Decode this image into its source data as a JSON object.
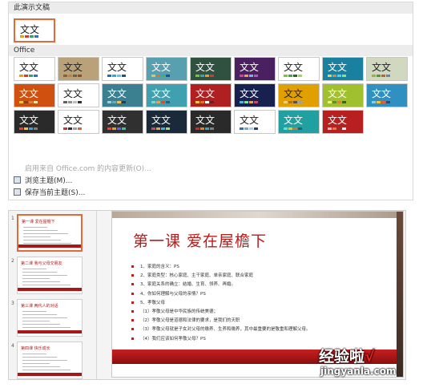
{
  "gallery": {
    "this_presentation_label": "此演示文稿",
    "office_label": "Office",
    "sample_text": "文文",
    "current_theme_text": "文文",
    "menu": {
      "enable_updates": "启用来自 Office.com 的内容更新(O)...",
      "browse": "浏览主题(M)...",
      "save": "保存当前主题(S)..."
    },
    "themes": [
      {
        "bg": "#ffffff",
        "fg": "#222222",
        "bars": [
          "#e4a020",
          "#d04020",
          "#40a060",
          "#3070c0"
        ]
      },
      {
        "bg": "#b9a27a",
        "fg": "#222222",
        "bars": [
          "#8a6030",
          "#c08040",
          "#606060",
          "#a04030"
        ]
      },
      {
        "bg": "#ffffff",
        "fg": "#222222",
        "bars": [
          "#2070b0",
          "#40a0d0",
          "#70c0e0",
          "#205080"
        ]
      },
      {
        "bg": "#58a0b0",
        "fg": "#ffffff",
        "bars": [
          "#f0c040",
          "#e07030",
          "#40b070",
          "#2050a0"
        ]
      },
      {
        "bg": "#305040",
        "fg": "#ffffff",
        "bars": [
          "#80c040",
          "#40a0c0",
          "#e0a030",
          "#c04040"
        ]
      },
      {
        "bg": "#4a2060",
        "fg": "#ffffff",
        "bars": [
          "#e04080",
          "#f0a040",
          "#60c0e0",
          "#a060c0"
        ]
      },
      {
        "bg": "#ffffff",
        "fg": "#222222",
        "bars": [
          "#80c040",
          "#40a060",
          "#306030",
          "#a0d060"
        ]
      },
      {
        "bg": "#1a80a0",
        "fg": "#ffffff",
        "bars": [
          "#f0d040",
          "#f08030",
          "#60d0d0",
          "#a0e060"
        ]
      },
      {
        "bg": "#d0d8c0",
        "fg": "#222222",
        "bars": [
          "#a0b040",
          "#609040",
          "#c06030",
          "#7080a0"
        ]
      },
      {
        "bg": "#d05010",
        "fg": "#ffffff",
        "bars": [
          "#f0c040",
          "#904010",
          "#e08030",
          "#f0e0a0"
        ]
      },
      {
        "bg": "#ffffff",
        "fg": "#222222",
        "bars": [
          "#606060",
          "#909090",
          "#c0c0c0",
          "#303030"
        ]
      },
      {
        "bg": "#3a8090",
        "fg": "#ffffff",
        "bars": [
          "#a0d0e0",
          "#60b0c0",
          "#f0c060",
          "#204050"
        ]
      },
      {
        "bg": "#40a0b0",
        "fg": "#ffffff",
        "bars": [
          "#80d0d0",
          "#f0a040",
          "#d05030",
          "#306070"
        ]
      },
      {
        "bg": "#b02020",
        "fg": "#ffffff",
        "bars": [
          "#f0c040",
          "#e07030",
          "#ffffff",
          "#702010"
        ]
      },
      {
        "bg": "#182050",
        "fg": "#ffffff",
        "bars": [
          "#40c0e0",
          "#80e0a0",
          "#f0a040",
          "#e04060"
        ]
      },
      {
        "bg": "#e0a000",
        "fg": "#222222",
        "bars": [
          "#f0d060",
          "#c07000",
          "#605040",
          "#a0a0a0"
        ]
      },
      {
        "bg": "#a0c030",
        "fg": "#ffffff",
        "bars": [
          "#f0f080",
          "#609020",
          "#e08030",
          "#406020"
        ]
      },
      {
        "bg": "#3090c0",
        "fg": "#ffffff",
        "bars": [
          "#80d0f0",
          "#f0c040",
          "#e06030",
          "#205080"
        ]
      },
      {
        "bg": "#2a2a2a",
        "fg": "#ffffff",
        "bars": [
          "#e04040",
          "#f0c040",
          "#40a0e0",
          "#808080"
        ]
      },
      {
        "bg": "#ffffff",
        "fg": "#222222",
        "bars": [
          "#d03030",
          "#303030",
          "#a0a0a0",
          "#e06030"
        ]
      },
      {
        "bg": "#303030",
        "fg": "#ffffff",
        "bars": [
          "#f04040",
          "#e0a030",
          "#6060e0",
          "#40c0a0"
        ]
      },
      {
        "bg": "#1a2a3a",
        "fg": "#ffffff",
        "bars": [
          "#e04050",
          "#f0a030",
          "#40b0e0",
          "#a0e060"
        ]
      },
      {
        "bg": "#2a2a2a",
        "fg": "#ffffff",
        "bars": [
          "#c03030",
          "#e08030",
          "#40a0c0",
          "#808080"
        ]
      },
      {
        "bg": "#ffffff",
        "fg": "#222222",
        "bars": [
          "#3070c0",
          "#60b0e0",
          "#a0d0f0",
          "#204080"
        ]
      },
      {
        "bg": "#20a0a0",
        "fg": "#ffffff",
        "bars": [
          "#60e0d0",
          "#f0c040",
          "#e07030",
          "#206070"
        ]
      },
      {
        "bg": "#b82020",
        "fg": "#ffffff",
        "bars": [
          "#f0c0c0",
          "#e08040",
          "#704030",
          "#ffffff"
        ]
      }
    ]
  },
  "slides_pane": {
    "items": [
      {
        "num": "1",
        "title": "第一课 爱在屋檐下"
      },
      {
        "num": "2",
        "title": "第二课 我与父母交朋友"
      },
      {
        "num": "3",
        "title": "第三课 两代人的对话"
      },
      {
        "num": "4",
        "title": "第四课 快乐成长"
      }
    ]
  },
  "slide": {
    "title": "第一课 爱在屋檐下",
    "bullets": [
      "1、家庭的含义：PS",
      "2、家庭类型：核心家庭、主干家庭、单亲家庭、联合家庭",
      "3、家庭关系的确立：结婚、生育、领养、再婚。",
      "4、你如何理解与父母的亲情？PS",
      "5、孝敬父母",
      "（1）孝敬父母是中华民族的传统美德；",
      "（2）孝敬父母是道德和法律的要求，是我们的天职",
      "（3）孝敬父母就是子女对父母的赡养、生养和赡养，其中最重要的是敬重和理解父母。",
      "（4）我们应该如何孝敬父母？PS"
    ]
  },
  "watermark": {
    "brand": "经验啦",
    "check": "√",
    "url": "jingyanla.com"
  }
}
